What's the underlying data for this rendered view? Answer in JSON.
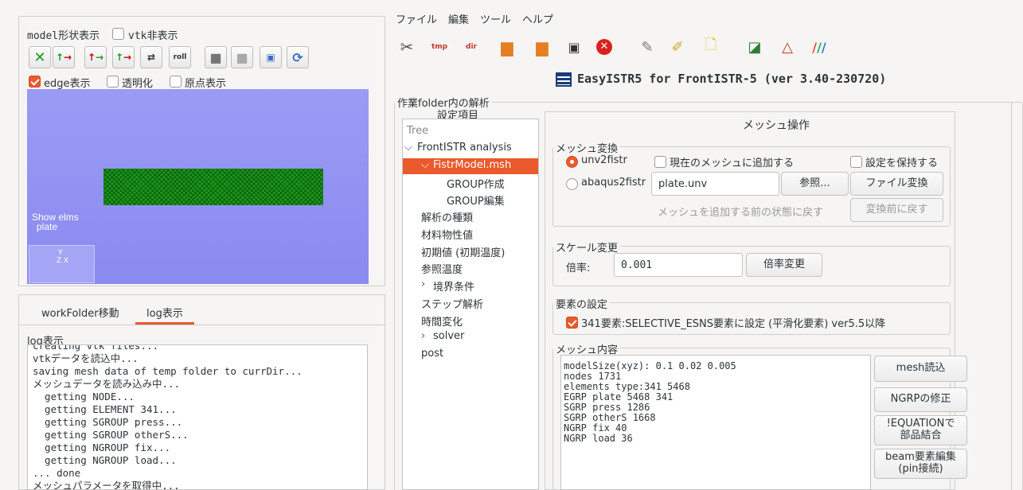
{
  "left_panel": {
    "model_label": "model形状表示",
    "vtk_hide_label": "vtk非表示",
    "view_buttons": [
      "fit",
      "x",
      "y",
      "z",
      "flip",
      "roll",
      "solid",
      "wire",
      "capture",
      "reload"
    ],
    "edge_label": "edge表示",
    "edge_checked": true,
    "transparent_label": "透明化",
    "origin_label": "原点表示",
    "viewport": {
      "overlay_line1": "Show elms",
      "overlay_line2": "plate",
      "axis_y": "Y",
      "axis_zx": "Z X",
      "background_color": "#8d8df2",
      "mesh_color": "#1a9a1a"
    }
  },
  "bottom_panel": {
    "tabs": [
      "workFolder移動",
      "log表示"
    ],
    "active_tab": "log表示",
    "log_label": "log表示",
    "log_lines": [
      "creating vtk files...",
      "vtkデータを読込中...",
      "saving mesh data of temp folder to currDir...",
      "メッシュデータを読み込み中...",
      "  getting NODE...",
      "  getting ELEMENT 341...",
      "  getting SGROUP press...",
      "  getting SGROUP otherS...",
      "  getting NGROUP fix...",
      "  getting NGROUP load...",
      "... done",
      "メッシュパラメータを取得中..."
    ]
  },
  "menu": [
    "ファイル",
    "編集",
    "ツール",
    "ヘルプ"
  ],
  "toolbar_icons": [
    "scissors-icon",
    "tmp-icon",
    "dir-icon",
    "folder-open-icon",
    "folder-save-icon",
    "terminal-icon",
    "close-red-icon",
    "edit-icon",
    "brush-icon",
    "new-file-icon",
    "paraview-icon",
    "tri-icon",
    "colors-icon"
  ],
  "app_title": "EasyISTR5 for FrontISTR-5  (ver 3.40-230720)",
  "workfolder_frame": "作業folder内の解析",
  "settings_label": "設定項目",
  "tree": {
    "header": "Tree",
    "items": [
      {
        "label": "FrontISTR analysis",
        "level": 0,
        "expander": "open"
      },
      {
        "label": "FistrModel.msh",
        "level": 1,
        "expander": "open",
        "selected": true
      },
      {
        "label": "GROUP作成",
        "level": 2
      },
      {
        "label": "GROUP編集",
        "level": 2
      },
      {
        "label": "解析の種類",
        "level": 1
      },
      {
        "label": "材料物性値",
        "level": 1
      },
      {
        "label": "初期値 (初期温度)",
        "level": 1
      },
      {
        "label": "参照温度",
        "level": 1
      },
      {
        "label": "境界条件",
        "level": 1,
        "expander": "closed"
      },
      {
        "label": "ステップ解析",
        "level": 1
      },
      {
        "label": "時間変化",
        "level": 1
      },
      {
        "label": "solver",
        "level": 1,
        "expander": "closed"
      },
      {
        "label": "post",
        "level": 1
      }
    ]
  },
  "mesh_ops": {
    "title": "メッシュ操作",
    "convert": {
      "frame": "メッシュ変換",
      "unv_label": "unv2fistr",
      "abaqus_label": "abaqus2fistr",
      "add_label": "現在のメッシュに追加する",
      "keep_label": "設定を保持する",
      "file_value": "plate.unv",
      "browse": "参照...",
      "convert_btn": "ファイル変換",
      "restore_before_add": "メッシュを追加する前の状態に戻す",
      "restore_before_convert": "変換前に戻す"
    },
    "scale": {
      "frame": "スケール変更",
      "ratio_label": "倍率:",
      "ratio_value": "0.001",
      "apply": "倍率変更"
    },
    "element": {
      "frame": "要素の設定",
      "checkbox_label": "341要素:SELECTIVE_ESNS要素に設定 (平滑化要素)  ver5.5以降",
      "checked": true
    },
    "content": {
      "frame": "メッシュ内容",
      "lines": [
        "modelSize(xyz): 0.1 0.02 0.005",
        "",
        "nodes 1731",
        "elements type:341 5468",
        "",
        "EGRP plate 5468 341",
        "SGRP press 1286",
        "SGRP otherS 1668",
        "NGRP fix 40",
        "NGRP load 36"
      ],
      "buttons": {
        "read": "mesh読込",
        "fix": "NGRPの修正",
        "equation_1": "!EQUATIONで",
        "equation_2": "部品結合",
        "beam_1": "beam要素編集",
        "beam_2": "(pin接続)"
      }
    }
  }
}
